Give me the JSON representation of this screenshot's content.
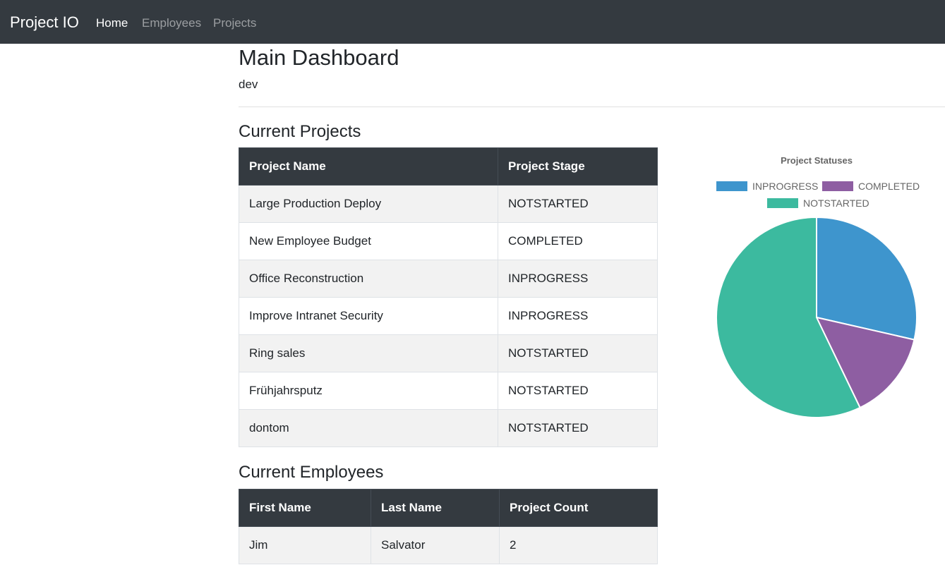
{
  "navbar": {
    "brand": "Project IO",
    "links": [
      "Home",
      "Employees",
      "Projects"
    ]
  },
  "page": {
    "title": "Main Dashboard",
    "subtitle": "dev"
  },
  "projects": {
    "heading": "Current Projects",
    "columns": [
      "Project Name",
      "Project Stage"
    ],
    "rows": [
      [
        "Large Production Deploy",
        "NOTSTARTED"
      ],
      [
        "New Employee Budget",
        "COMPLETED"
      ],
      [
        "Office Reconstruction",
        "INPROGRESS"
      ],
      [
        "Improve Intranet Security",
        "INPROGRESS"
      ],
      [
        "Ring sales",
        "NOTSTARTED"
      ],
      [
        "Frühjahrsputz",
        "NOTSTARTED"
      ],
      [
        "dontom",
        "NOTSTARTED"
      ]
    ]
  },
  "employees": {
    "heading": "Current Employees",
    "columns": [
      "First Name",
      "Last Name",
      "Project Count"
    ],
    "rows": [
      [
        "Jim",
        "Salvator",
        "2"
      ]
    ]
  },
  "chart_data": {
    "type": "pie",
    "title": "Project Statuses",
    "categories": [
      "INPROGRESS",
      "COMPLETED",
      "NOTSTARTED"
    ],
    "values": [
      2,
      1,
      4
    ],
    "colors": [
      "#3e95cd",
      "#8e5ea2",
      "#3cba9f"
    ],
    "legend": "top"
  }
}
